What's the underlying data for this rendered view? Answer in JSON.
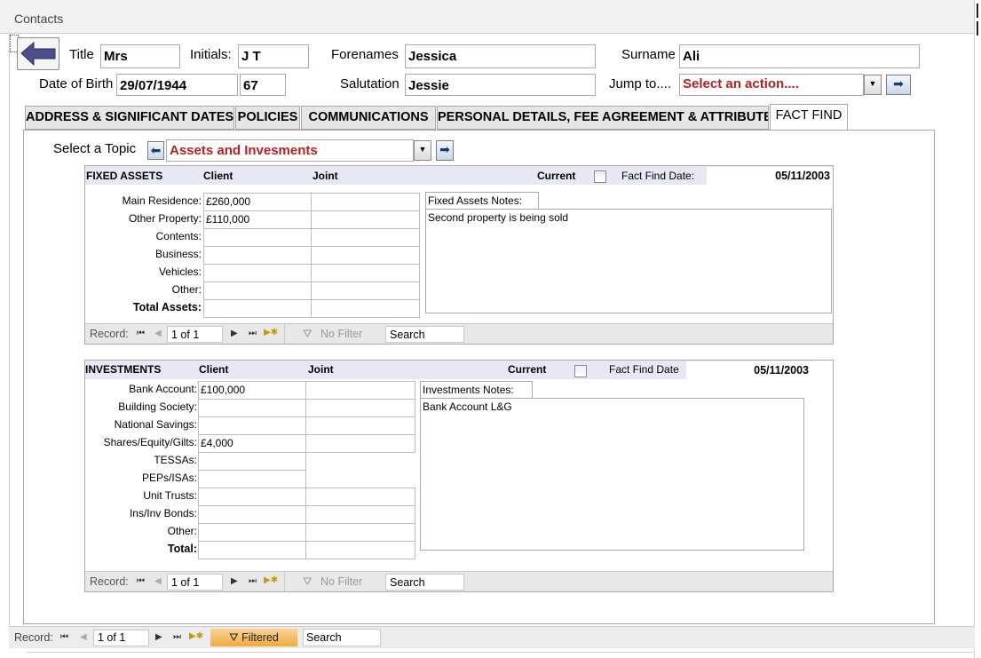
{
  "window": {
    "title": "Contacts"
  },
  "header": {
    "title_label": "Title",
    "title_value": "Mrs",
    "initials_label": "Initials:",
    "initials_value": "J T",
    "forenames_label": "Forenames",
    "forenames_value": "Jessica",
    "surname_label": "Surname",
    "surname_value": "Ali",
    "dob_label": "Date of Birth",
    "dob_value": "29/07/1944",
    "age_value": "67",
    "salutation_label": "Salutation",
    "salutation_value": "Jessie",
    "jump_label": "Jump to....",
    "jump_value": "Select an action...."
  },
  "tabs": [
    {
      "label": "ADDRESS & SIGNIFICANT DATES"
    },
    {
      "label": "POLICIES"
    },
    {
      "label": "COMMUNICATIONS"
    },
    {
      "label": "PERSONAL DETAILS, FEE AGREEMENT & ATTRIBUTES"
    },
    {
      "label": "FACT FIND",
      "active": true
    }
  ],
  "topic": {
    "label": "Select a Topic",
    "value": "Assets and Invesments"
  },
  "fixed_assets": {
    "heading": "FIXED ASSETS",
    "client": "Client",
    "joint": "Joint",
    "current": "Current",
    "date_label": "Fact Find Date:",
    "date_value": "05/11/2003",
    "rows": [
      {
        "label": "Main Residence:",
        "client": "£260,000",
        "joint": ""
      },
      {
        "label": "Other Property:",
        "client": "£110,000",
        "joint": ""
      },
      {
        "label": "Contents:",
        "client": "",
        "joint": ""
      },
      {
        "label": "Business:",
        "client": "",
        "joint": ""
      },
      {
        "label": "Vehicles:",
        "client": "",
        "joint": ""
      },
      {
        "label": "Other:",
        "client": "",
        "joint": ""
      },
      {
        "label": "Total Assets:",
        "client": "",
        "joint": ""
      }
    ],
    "notes_label": "Fixed Assets Notes:",
    "notes_value": "Second property is being sold"
  },
  "investments": {
    "heading": "INVESTMENTS",
    "client": "Client",
    "joint": "Joint",
    "current": "Current",
    "date_label": "Fact Find Date",
    "date_value": "05/11/2003",
    "rows": [
      {
        "label": "Bank Account:",
        "client": "£100,000",
        "joint": ""
      },
      {
        "label": "Building Society:",
        "client": "",
        "joint": ""
      },
      {
        "label": "National Savings:",
        "client": "",
        "joint": ""
      },
      {
        "label": "Shares/Equity/Gilts:",
        "client": "£4,000",
        "joint": ""
      },
      {
        "label": "TESSAs:",
        "client": ""
      },
      {
        "label": "PEPs/ISAs:",
        "client": ""
      },
      {
        "label": "Unit Trusts:",
        "client": "",
        "joint": ""
      },
      {
        "label": "Ins/Inv Bonds:",
        "client": "",
        "joint": ""
      },
      {
        "label": "Other:",
        "client": "",
        "joint": ""
      },
      {
        "label": "Total:",
        "client": "",
        "joint": ""
      }
    ],
    "notes_label": "Investments Notes:",
    "notes_value": "Bank Account L&G"
  },
  "record_nav": {
    "label": "Record:",
    "position": "1 of 1",
    "filter": "No Filter",
    "filtered": "Filtered",
    "search": "Search"
  }
}
